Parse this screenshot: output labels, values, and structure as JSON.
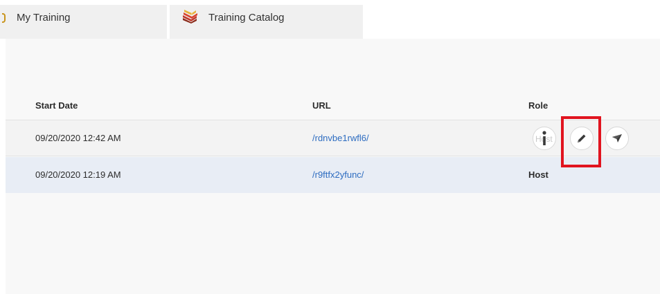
{
  "tabs": {
    "my_training": "My Training",
    "training_catalog": "Training Catalog"
  },
  "table": {
    "headers": {
      "start_date": "Start Date",
      "url": "URL",
      "role": "Role"
    },
    "rows": [
      {
        "start_date": "09/20/2020 12:42 AM",
        "url": "/rdnvbe1rwfl6/",
        "role": "Host",
        "actions": [
          "info-icon",
          "pencil-icon",
          "send-icon"
        ]
      },
      {
        "start_date": "09/20/2020 12:19 AM",
        "url": "/r9ftfx2yfunc/",
        "role": "Host"
      }
    ]
  },
  "colors": {
    "link": "#2d6cc0",
    "highlight": "#e1141f",
    "selected_row": "#e8edf5"
  }
}
